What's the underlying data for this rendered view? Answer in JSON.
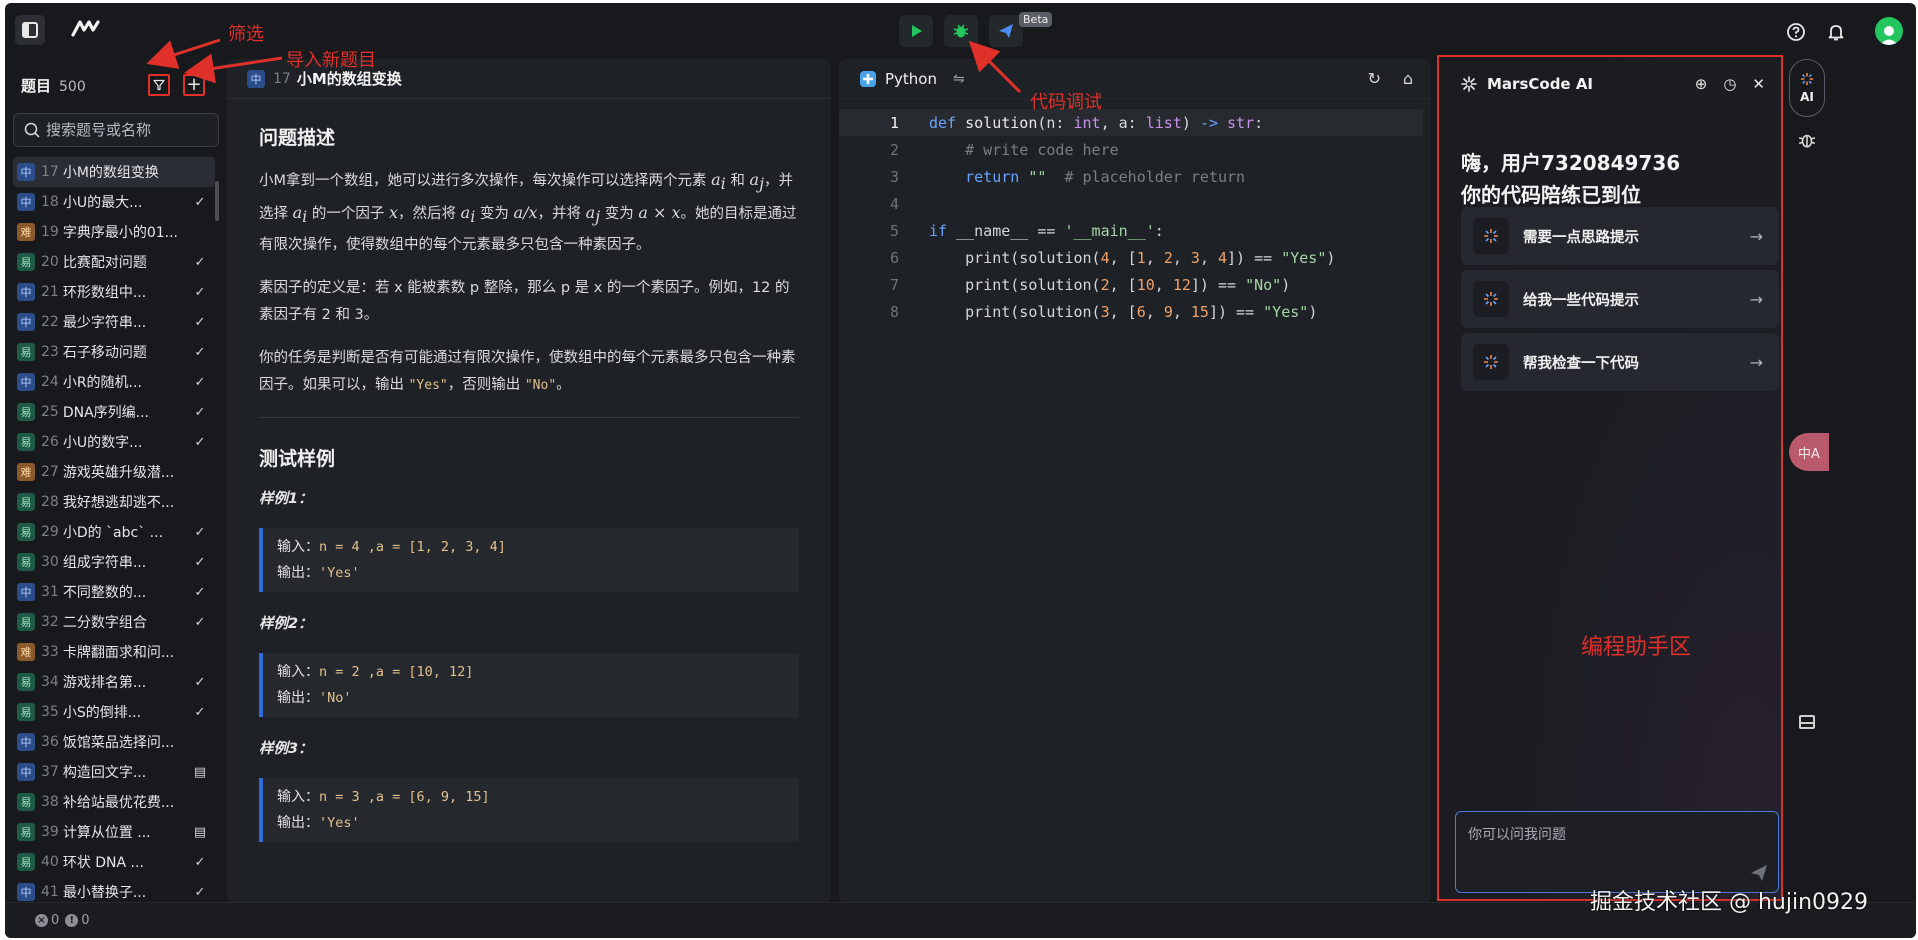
{
  "topbar": {
    "beta_label": "Beta"
  },
  "sidebar": {
    "title": "题目",
    "count": "500",
    "search_placeholder": "搜索题号或名称",
    "problems": [
      {
        "tag": "中",
        "level": "mid",
        "num": "17",
        "title": "小M的数组变换",
        "status": "",
        "active": true
      },
      {
        "tag": "中",
        "level": "mid",
        "num": "18",
        "title": "小U的最大...",
        "status": "✓"
      },
      {
        "tag": "难",
        "level": "hard",
        "num": "19",
        "title": "字典序最小的01...",
        "status": ""
      },
      {
        "tag": "易",
        "level": "easy",
        "num": "20",
        "title": "比赛配对问题",
        "status": "✓"
      },
      {
        "tag": "中",
        "level": "mid",
        "num": "21",
        "title": "环形数组中...",
        "status": "✓"
      },
      {
        "tag": "中",
        "level": "mid",
        "num": "22",
        "title": "最少字符串...",
        "status": "✓"
      },
      {
        "tag": "易",
        "level": "easy",
        "num": "23",
        "title": "石子移动问题",
        "status": "✓"
      },
      {
        "tag": "中",
        "level": "mid",
        "num": "24",
        "title": "小R的随机...",
        "status": "✓"
      },
      {
        "tag": "易",
        "level": "easy",
        "num": "25",
        "title": "DNA序列编...",
        "status": "✓"
      },
      {
        "tag": "易",
        "level": "easy",
        "num": "26",
        "title": "小U的数字...",
        "status": "✓"
      },
      {
        "tag": "难",
        "level": "hard",
        "num": "27",
        "title": "游戏英雄升级潜...",
        "status": ""
      },
      {
        "tag": "易",
        "level": "easy",
        "num": "28",
        "title": "我好想逃却逃不...",
        "status": ""
      },
      {
        "tag": "易",
        "level": "easy",
        "num": "29",
        "title": "小D的 `abc` ...",
        "status": "✓"
      },
      {
        "tag": "易",
        "level": "easy",
        "num": "30",
        "title": "组成字符串...",
        "status": "✓"
      },
      {
        "tag": "中",
        "level": "mid",
        "num": "31",
        "title": "不同整数的...",
        "status": "✓"
      },
      {
        "tag": "易",
        "level": "easy",
        "num": "32",
        "title": "二分数字组合",
        "status": "✓"
      },
      {
        "tag": "难",
        "level": "hard",
        "num": "33",
        "title": "卡牌翻面求和问...",
        "status": ""
      },
      {
        "tag": "易",
        "level": "easy",
        "num": "34",
        "title": "游戏排名第...",
        "status": "✓"
      },
      {
        "tag": "易",
        "level": "easy",
        "num": "35",
        "title": "小S的倒排...",
        "status": "✓"
      },
      {
        "tag": "中",
        "level": "mid",
        "num": "36",
        "title": "饭馆菜品选择问...",
        "status": ""
      },
      {
        "tag": "中",
        "level": "mid",
        "num": "37",
        "title": "构造回文字...",
        "status": "▤"
      },
      {
        "tag": "易",
        "level": "easy",
        "num": "38",
        "title": "补给站最优花费...",
        "status": ""
      },
      {
        "tag": "易",
        "level": "easy",
        "num": "39",
        "title": "计算从位置 ...",
        "status": "▤"
      },
      {
        "tag": "易",
        "level": "easy",
        "num": "40",
        "title": "环状 DNA ...",
        "status": "✓"
      },
      {
        "tag": "中",
        "level": "mid",
        "num": "41",
        "title": "最小替换子...",
        "status": "✓"
      }
    ]
  },
  "problem": {
    "tag": "中",
    "num": "17",
    "title": "小M的数组变换",
    "desc_heading": "问题描述",
    "p1_a": "小M拿到一个数组，她可以进行多次操作，每次操作可以选择两个元素 ",
    "p1_ai": "a",
    "p1_b": " 和 ",
    "p1_aj": "a",
    "p1_c": "，并选择 ",
    "p1_ai2": "a",
    "p1_d": " 的一个因子 ",
    "p1_x": "x",
    "p1_e": "，然后将 ",
    "p1_ai3": "a",
    "p1_f": " 变为 ",
    "p1_div": "a/x",
    "p1_g": "，并将 ",
    "p1_aj2": "a",
    "p1_h": " 变为 ",
    "p1_mul": "a × x",
    "p1_i": "。她的目标是通过有限次操作，使得数组中的每个元素最多只包含一种素因子。",
    "p2": "素因子的定义是：若 x 能被素数 p 整除，那么 p 是 x 的一个素因子。例如，12 的素因子有 2 和 3。",
    "p3_a": "你的任务是判断是否有可能通过有限次操作，使数组中的每个元素最多只包含一种素因子。如果可以，输出 ",
    "p3_yes": "\"Yes\"",
    "p3_b": "，否则输出 ",
    "p3_no": "\"No\"",
    "p3_c": "。",
    "tests_heading": "测试样例",
    "samples": [
      {
        "title": "样例1：",
        "input_label": "输入：",
        "input": "n = 4 ,a = [1, 2, 3, 4]",
        "output_label": "输出：",
        "output": "'Yes'"
      },
      {
        "title": "样例2：",
        "input_label": "输入：",
        "input": "n = 2 ,a = [10, 12]",
        "output_label": "输出：",
        "output": "'No'"
      },
      {
        "title": "样例3：",
        "input_label": "输入：",
        "input": "n = 3 ,a = [6, 9, 15]",
        "output_label": "输出：",
        "output": "'Yes'"
      }
    ]
  },
  "editor": {
    "language": "Python",
    "line_numbers": [
      "1",
      "2",
      "3",
      "4",
      "5",
      "6",
      "7",
      "8"
    ]
  },
  "assistant": {
    "title": "MarsCode AI",
    "greeting_line1": "嗨，用户7320849736",
    "greeting_line2": "你的代码陪练已到位",
    "suggestions": [
      "需要一点思路提示",
      "给我一些代码提示",
      "帮我检查一下代码"
    ],
    "input_placeholder": "你可以问我问题",
    "zone_label": "编程助手区"
  },
  "rail": {
    "ai_label": "AI",
    "translate_label": "中A"
  },
  "statusbar": {
    "errors": "0",
    "warnings": "0"
  },
  "annotations": {
    "filter": "筛选",
    "import": "导入新题目",
    "debug": "代码调试"
  },
  "watermark": "掘金技术社区 @ hujin0929",
  "colors": {
    "annotation_red": "#e0302a",
    "run_green": "#22c55e",
    "sample_border": "#2f6bd9"
  }
}
